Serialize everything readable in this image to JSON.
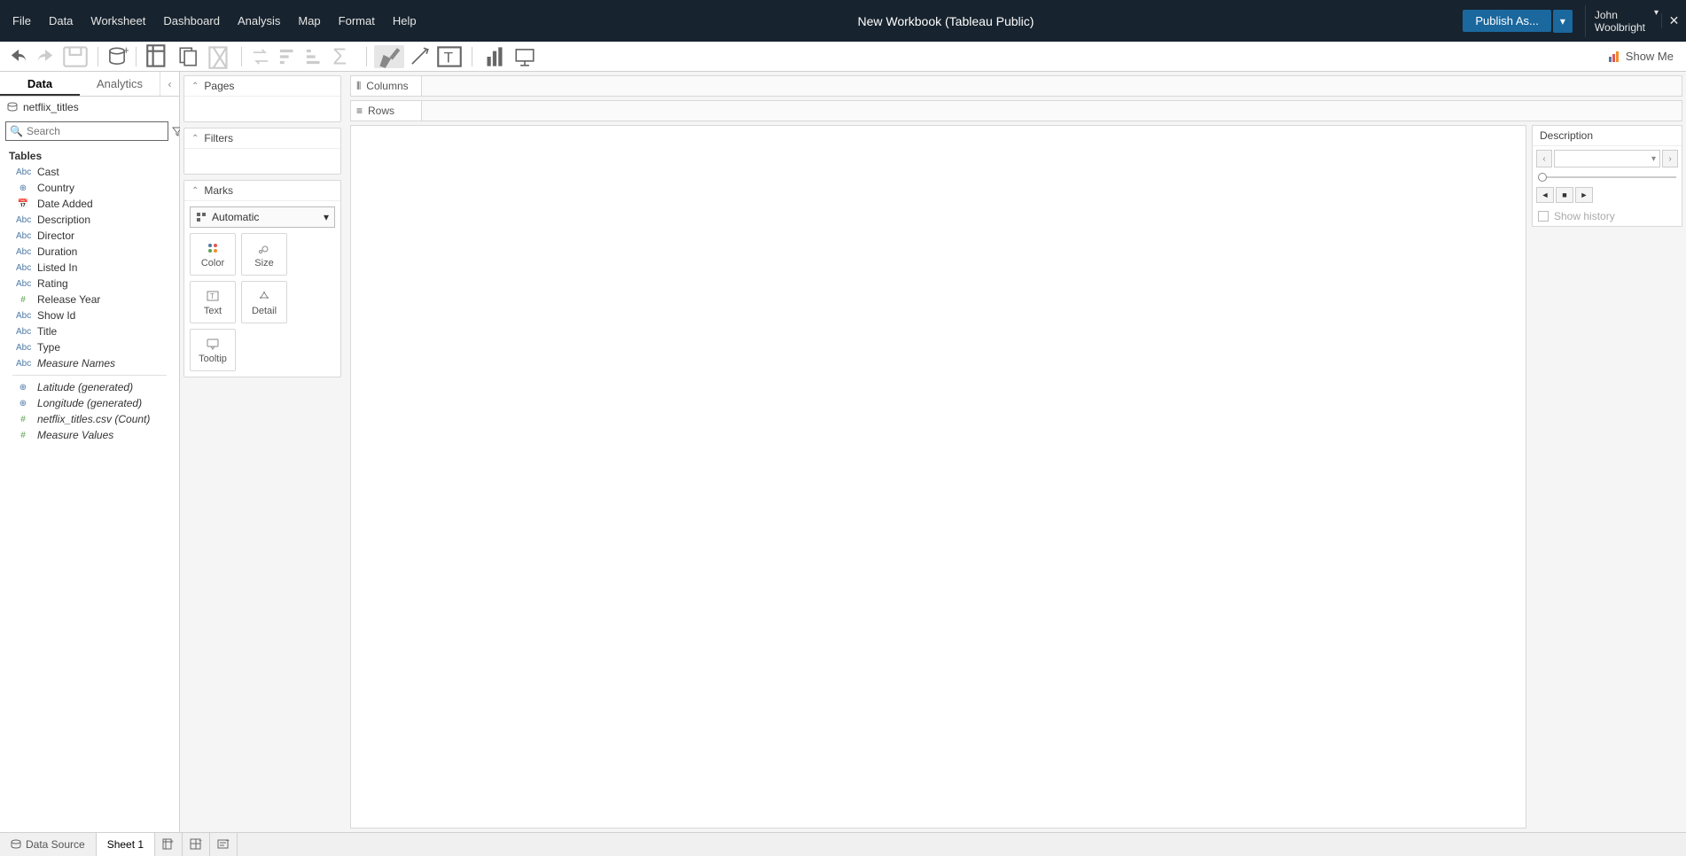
{
  "title": "New Workbook (Tableau Public)",
  "menu": [
    "File",
    "Data",
    "Worksheet",
    "Dashboard",
    "Analysis",
    "Map",
    "Format",
    "Help"
  ],
  "publish": "Publish As...",
  "user": {
    "first": "John",
    "last": "Woolbright"
  },
  "showme": "Show Me",
  "left": {
    "tabs": [
      "Data",
      "Analytics"
    ],
    "datasource": "netflix_titles",
    "search_placeholder": "Search",
    "tables_header": "Tables",
    "fields": [
      {
        "icon": "abc",
        "label": "Cast"
      },
      {
        "icon": "globe",
        "label": "Country"
      },
      {
        "icon": "cal",
        "label": "Date Added"
      },
      {
        "icon": "abc",
        "label": "Description"
      },
      {
        "icon": "abc",
        "label": "Director"
      },
      {
        "icon": "abc",
        "label": "Duration"
      },
      {
        "icon": "abc",
        "label": "Listed In"
      },
      {
        "icon": "abc",
        "label": "Rating"
      },
      {
        "icon": "hash",
        "label": "Release Year"
      },
      {
        "icon": "abc",
        "label": "Show Id"
      },
      {
        "icon": "abc",
        "label": "Title"
      },
      {
        "icon": "abc",
        "label": "Type"
      },
      {
        "icon": "abc",
        "label": "Measure Names",
        "italic": true
      }
    ],
    "measures": [
      {
        "icon": "globe",
        "label": "Latitude (generated)",
        "italic": true
      },
      {
        "icon": "globe",
        "label": "Longitude (generated)",
        "italic": true
      },
      {
        "icon": "hash",
        "label": "netflix_titles.csv (Count)",
        "italic": true
      },
      {
        "icon": "hash",
        "label": "Measure Values",
        "italic": true
      }
    ]
  },
  "cards": {
    "pages": "Pages",
    "filters": "Filters",
    "marks": "Marks",
    "marks_type": "Automatic",
    "mark_buttons": [
      "Color",
      "Size",
      "Text",
      "Detail",
      "Tooltip"
    ]
  },
  "shelves": {
    "columns": "Columns",
    "rows": "Rows"
  },
  "right": {
    "title": "Description",
    "show_history": "Show history"
  },
  "bottom": {
    "datasource": "Data Source",
    "sheet": "Sheet 1"
  }
}
